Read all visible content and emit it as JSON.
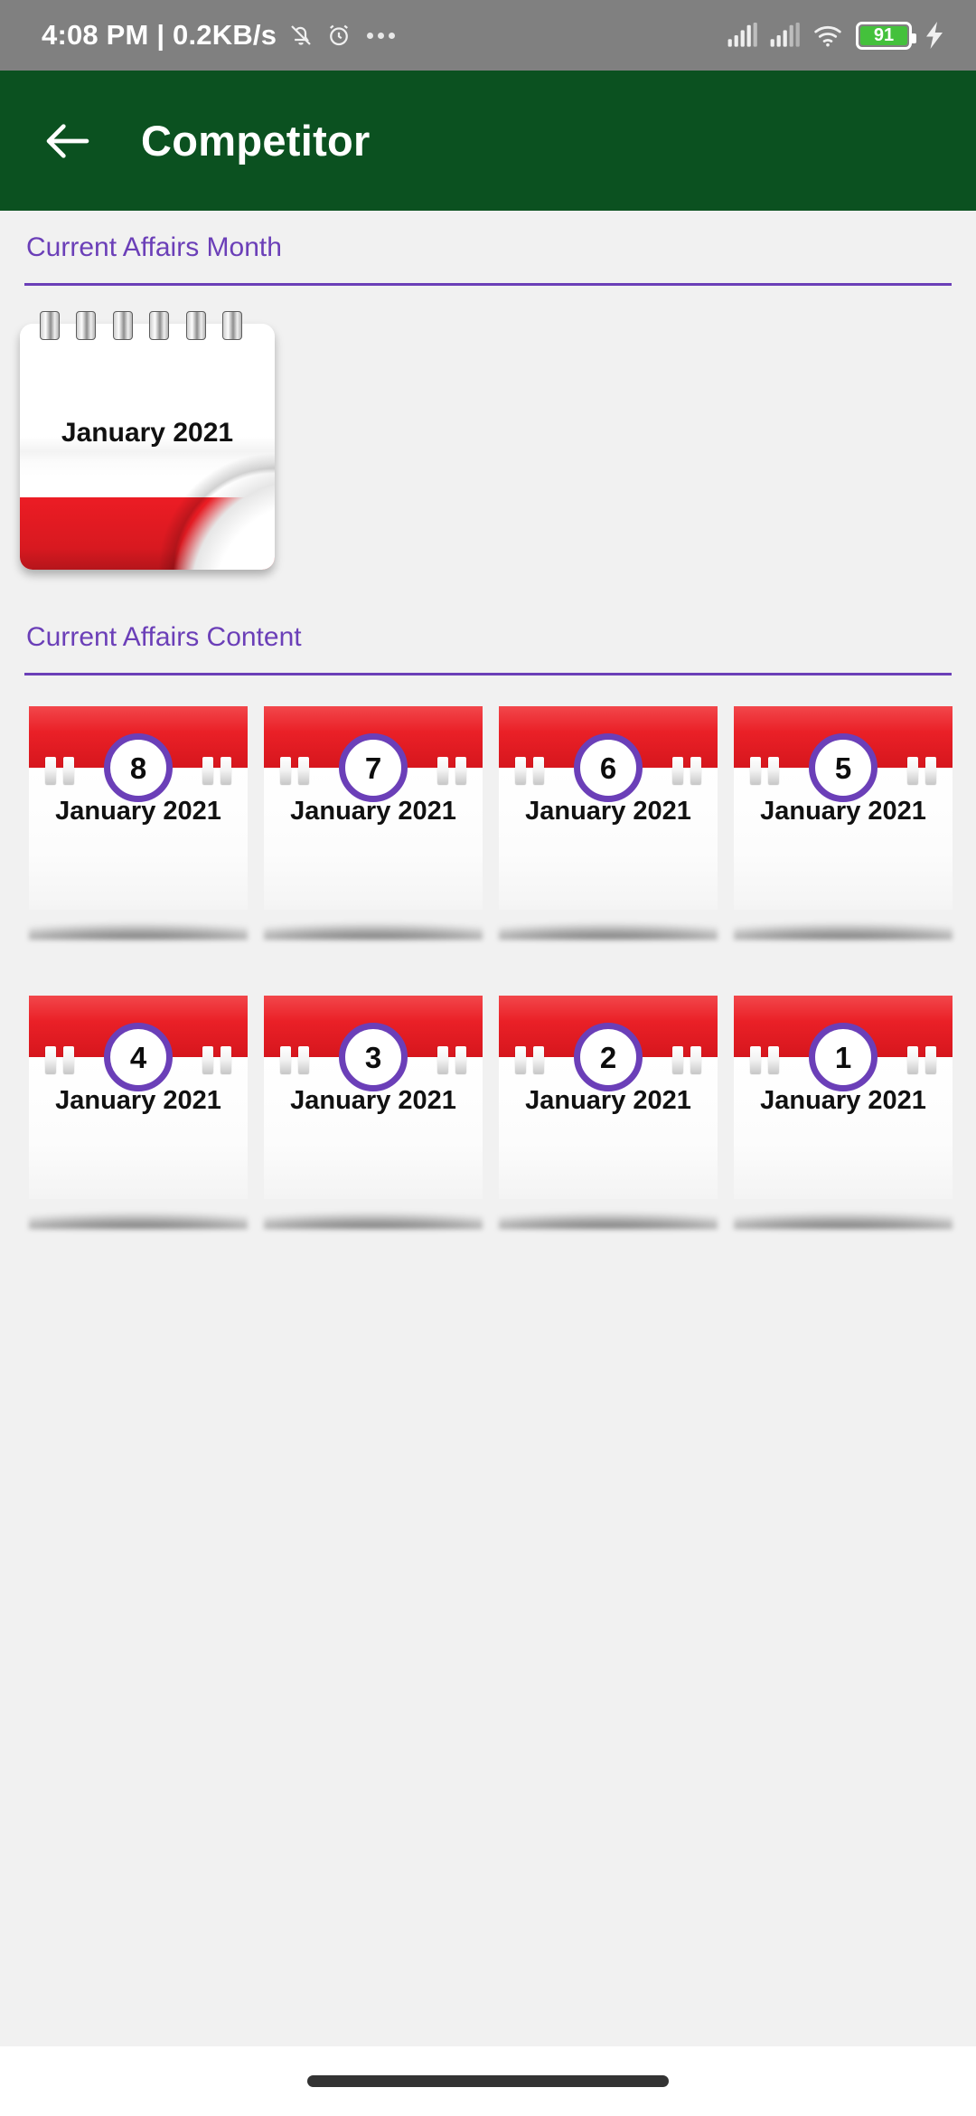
{
  "status_bar": {
    "time_and_net": "4:08 PM | 0.2KB/s",
    "icons": [
      "bell-mute-icon",
      "alarm-clock-icon",
      "overflow-dots-icon",
      "signal-1-icon",
      "signal-2-icon",
      "wifi-icon",
      "battery-icon",
      "charging-bolt-icon"
    ],
    "battery_level": "91",
    "battery_color": "#44c13c",
    "background": "#808080"
  },
  "appbar": {
    "title": "Competitor",
    "back_icon": "arrow-left-icon",
    "background": "#0b5120",
    "text_color": "#ffffff"
  },
  "sections": {
    "month": {
      "title": "Current Affairs Month",
      "accent": "#6b3fb8"
    },
    "content": {
      "title": "Current Affairs Content",
      "accent": "#6b3fb8"
    }
  },
  "month_card": {
    "label": "January 2021",
    "red": "#ec1c24",
    "ring_count": 6
  },
  "days": [
    {
      "day": "8",
      "month": "January 2021"
    },
    {
      "day": "7",
      "month": "January 2021"
    },
    {
      "day": "6",
      "month": "January 2021"
    },
    {
      "day": "5",
      "month": "January 2021"
    },
    {
      "day": "4",
      "month": "January 2021"
    },
    {
      "day": "3",
      "month": "January 2021"
    },
    {
      "day": "2",
      "month": "January 2021"
    },
    {
      "day": "1",
      "month": "January 2021"
    }
  ],
  "nav_bar": {
    "gesture_pill": "home-gesture-pill",
    "color": "#333333"
  }
}
